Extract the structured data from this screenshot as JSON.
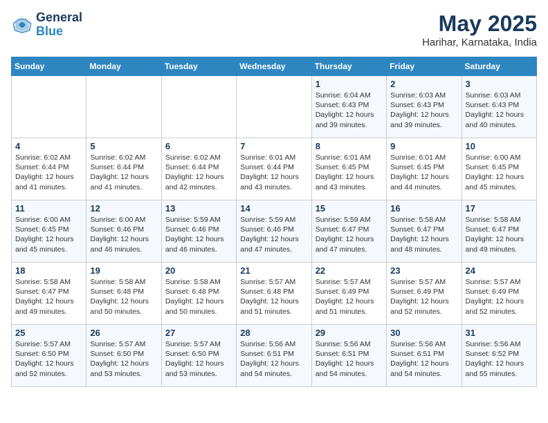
{
  "header": {
    "logo_line1": "General",
    "logo_line2": "Blue",
    "month_year": "May 2025",
    "location": "Harihar, Karnataka, India"
  },
  "days_of_week": [
    "Sunday",
    "Monday",
    "Tuesday",
    "Wednesday",
    "Thursday",
    "Friday",
    "Saturday"
  ],
  "weeks": [
    [
      {
        "day": "",
        "info": ""
      },
      {
        "day": "",
        "info": ""
      },
      {
        "day": "",
        "info": ""
      },
      {
        "day": "",
        "info": ""
      },
      {
        "day": "1",
        "info": "Sunrise: 6:04 AM\nSunset: 6:43 PM\nDaylight: 12 hours\nand 39 minutes."
      },
      {
        "day": "2",
        "info": "Sunrise: 6:03 AM\nSunset: 6:43 PM\nDaylight: 12 hours\nand 39 minutes."
      },
      {
        "day": "3",
        "info": "Sunrise: 6:03 AM\nSunset: 6:43 PM\nDaylight: 12 hours\nand 40 minutes."
      }
    ],
    [
      {
        "day": "4",
        "info": "Sunrise: 6:02 AM\nSunset: 6:44 PM\nDaylight: 12 hours\nand 41 minutes."
      },
      {
        "day": "5",
        "info": "Sunrise: 6:02 AM\nSunset: 6:44 PM\nDaylight: 12 hours\nand 41 minutes."
      },
      {
        "day": "6",
        "info": "Sunrise: 6:02 AM\nSunset: 6:44 PM\nDaylight: 12 hours\nand 42 minutes."
      },
      {
        "day": "7",
        "info": "Sunrise: 6:01 AM\nSunset: 6:44 PM\nDaylight: 12 hours\nand 43 minutes."
      },
      {
        "day": "8",
        "info": "Sunrise: 6:01 AM\nSunset: 6:45 PM\nDaylight: 12 hours\nand 43 minutes."
      },
      {
        "day": "9",
        "info": "Sunrise: 6:01 AM\nSunset: 6:45 PM\nDaylight: 12 hours\nand 44 minutes."
      },
      {
        "day": "10",
        "info": "Sunrise: 6:00 AM\nSunset: 6:45 PM\nDaylight: 12 hours\nand 45 minutes."
      }
    ],
    [
      {
        "day": "11",
        "info": "Sunrise: 6:00 AM\nSunset: 6:45 PM\nDaylight: 12 hours\nand 45 minutes."
      },
      {
        "day": "12",
        "info": "Sunrise: 6:00 AM\nSunset: 6:46 PM\nDaylight: 12 hours\nand 46 minutes."
      },
      {
        "day": "13",
        "info": "Sunrise: 5:59 AM\nSunset: 6:46 PM\nDaylight: 12 hours\nand 46 minutes."
      },
      {
        "day": "14",
        "info": "Sunrise: 5:59 AM\nSunset: 6:46 PM\nDaylight: 12 hours\nand 47 minutes."
      },
      {
        "day": "15",
        "info": "Sunrise: 5:59 AM\nSunset: 6:47 PM\nDaylight: 12 hours\nand 47 minutes."
      },
      {
        "day": "16",
        "info": "Sunrise: 5:58 AM\nSunset: 6:47 PM\nDaylight: 12 hours\nand 48 minutes."
      },
      {
        "day": "17",
        "info": "Sunrise: 5:58 AM\nSunset: 6:47 PM\nDaylight: 12 hours\nand 49 minutes."
      }
    ],
    [
      {
        "day": "18",
        "info": "Sunrise: 5:58 AM\nSunset: 6:47 PM\nDaylight: 12 hours\nand 49 minutes."
      },
      {
        "day": "19",
        "info": "Sunrise: 5:58 AM\nSunset: 6:48 PM\nDaylight: 12 hours\nand 50 minutes."
      },
      {
        "day": "20",
        "info": "Sunrise: 5:58 AM\nSunset: 6:48 PM\nDaylight: 12 hours\nand 50 minutes."
      },
      {
        "day": "21",
        "info": "Sunrise: 5:57 AM\nSunset: 6:48 PM\nDaylight: 12 hours\nand 51 minutes."
      },
      {
        "day": "22",
        "info": "Sunrise: 5:57 AM\nSunset: 6:49 PM\nDaylight: 12 hours\nand 51 minutes."
      },
      {
        "day": "23",
        "info": "Sunrise: 5:57 AM\nSunset: 6:49 PM\nDaylight: 12 hours\nand 52 minutes."
      },
      {
        "day": "24",
        "info": "Sunrise: 5:57 AM\nSunset: 6:49 PM\nDaylight: 12 hours\nand 52 minutes."
      }
    ],
    [
      {
        "day": "25",
        "info": "Sunrise: 5:57 AM\nSunset: 6:50 PM\nDaylight: 12 hours\nand 52 minutes."
      },
      {
        "day": "26",
        "info": "Sunrise: 5:57 AM\nSunset: 6:50 PM\nDaylight: 12 hours\nand 53 minutes."
      },
      {
        "day": "27",
        "info": "Sunrise: 5:57 AM\nSunset: 6:50 PM\nDaylight: 12 hours\nand 53 minutes."
      },
      {
        "day": "28",
        "info": "Sunrise: 5:56 AM\nSunset: 6:51 PM\nDaylight: 12 hours\nand 54 minutes."
      },
      {
        "day": "29",
        "info": "Sunrise: 5:56 AM\nSunset: 6:51 PM\nDaylight: 12 hours\nand 54 minutes."
      },
      {
        "day": "30",
        "info": "Sunrise: 5:56 AM\nSunset: 6:51 PM\nDaylight: 12 hours\nand 54 minutes."
      },
      {
        "day": "31",
        "info": "Sunrise: 5:56 AM\nSunset: 6:52 PM\nDaylight: 12 hours\nand 55 minutes."
      }
    ]
  ]
}
